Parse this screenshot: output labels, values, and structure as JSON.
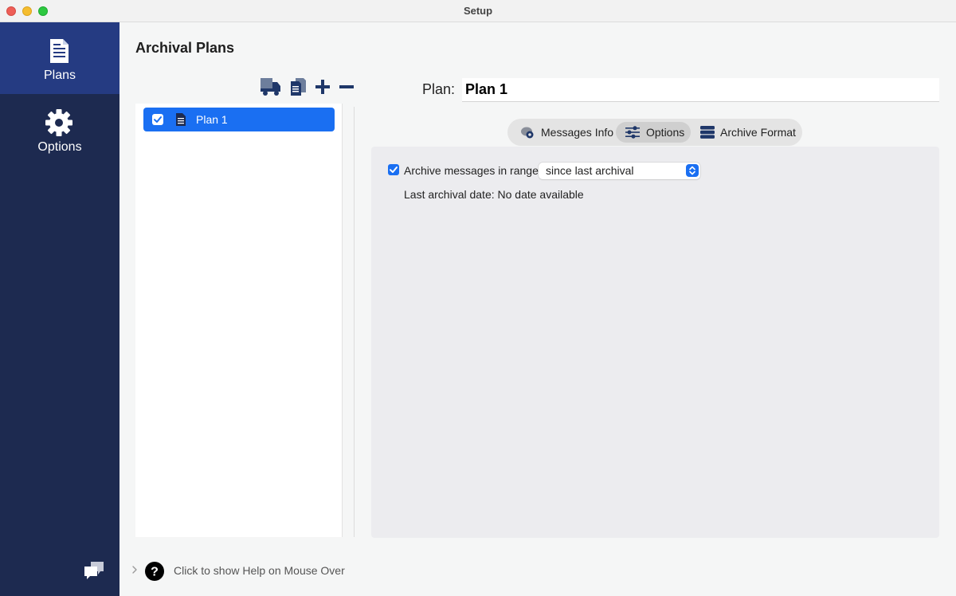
{
  "window": {
    "title": "Setup"
  },
  "sidebar": {
    "items": [
      {
        "label": "Plans",
        "icon": "document-icon",
        "active": true
      },
      {
        "label": "Options",
        "icon": "gear-icon",
        "active": false
      }
    ],
    "feedback_icon": "chat-bubbles-icon"
  },
  "main": {
    "title": "Archival Plans",
    "toolbar": [
      {
        "name": "truck-icon"
      },
      {
        "name": "duplicate-icon"
      },
      {
        "name": "add-icon"
      },
      {
        "name": "remove-icon"
      }
    ],
    "plans": [
      {
        "label": "Plan 1",
        "checked": true,
        "selected": true
      }
    ],
    "plan_field": {
      "label": "Plan:",
      "value": "Plan 1"
    },
    "tabs": [
      {
        "label": "Messages Info",
        "icon": "messages-info-icon",
        "active": false
      },
      {
        "label": "Options",
        "icon": "sliders-icon",
        "active": true
      },
      {
        "label": "Archive Format",
        "icon": "database-icon",
        "active": false
      }
    ],
    "options": {
      "range_checkbox_label": "Archive messages in range:",
      "range_checked": true,
      "range_select_value": "since last archival",
      "last_archival_text": "Last archival date: No date available"
    },
    "help": {
      "text": "Click to show Help on Mouse Over"
    }
  },
  "colors": {
    "sidebar_bg": "#1d2a50",
    "sidebar_active": "#253b82",
    "accent": "#1a6ff2",
    "icon_navy": "#1f3769"
  }
}
